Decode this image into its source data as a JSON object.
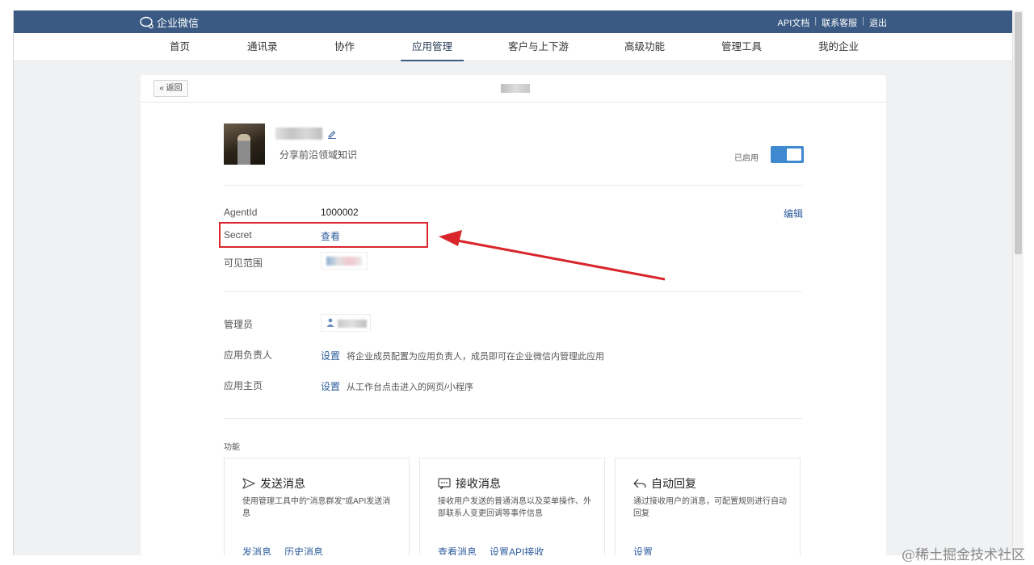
{
  "topbar": {
    "logo_text": "企业微信",
    "links": [
      "API文档",
      "联系客服",
      "退出"
    ],
    "separator": "|"
  },
  "nav": {
    "items": [
      "首页",
      "通讯录",
      "协作",
      "应用管理",
      "客户与上下游",
      "高级功能",
      "管理工具",
      "我的企业"
    ],
    "active": "应用管理"
  },
  "card": {
    "back_label": "« 返回",
    "app": {
      "description": "分享前沿领域知识",
      "status_label": "已启用",
      "enabled": true
    },
    "details": {
      "agentid_label": "AgentId",
      "agentid_value": "1000002",
      "edit_label": "编辑",
      "secret_label": "Secret",
      "secret_link": "查看",
      "visible_label": "可见范围"
    },
    "admin": {
      "admin_label": "管理员",
      "owner_label": "应用负责人",
      "owner_link": "设置",
      "owner_hint": "将企业成员配置为应用负责人，成员即可在企业微信内管理此应用",
      "home_label": "应用主页",
      "home_link": "设置",
      "home_hint": "从工作台点击进入的网页/小程序"
    },
    "features": {
      "section_label": "功能",
      "cards": [
        {
          "title": "发送消息",
          "icon": "send-icon",
          "desc": "使用管理工具中的\"消息群发\"或API发送消息",
          "links": [
            "发消息",
            "历史消息"
          ]
        },
        {
          "title": "接收消息",
          "icon": "chat-icon",
          "desc": "接收用户发送的普通消息以及菜单操作、外部联系人变更回调等事件信息",
          "links": [
            "查看消息",
            "设置API接收"
          ]
        },
        {
          "title": "自动回复",
          "icon": "reply-icon",
          "desc": "通过接收用户的消息，可配置规则进行自动回复",
          "links": [
            "设置"
          ]
        }
      ]
    }
  },
  "annotation": {
    "color": "#d9262b"
  },
  "watermark": "@稀土掘金技术社区",
  "colors": {
    "topbar": "#3a5a83",
    "link": "#2e5d9c",
    "toggle": "#3e89d0"
  }
}
